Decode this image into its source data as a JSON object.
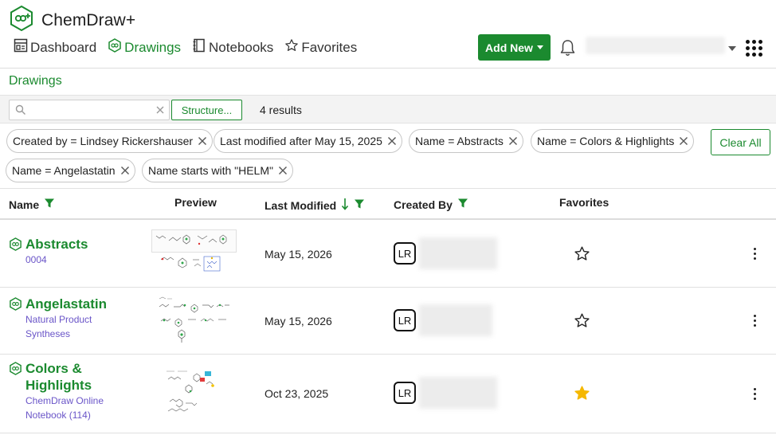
{
  "app": {
    "name": "ChemDraw+"
  },
  "nav": [
    {
      "label": "Dashboard",
      "icon": "dashboard-icon"
    },
    {
      "label": "Drawings",
      "icon": "drawing-icon",
      "active": true
    },
    {
      "label": "Notebooks",
      "icon": "notebook-icon"
    },
    {
      "label": "Favorites",
      "icon": "star-icon"
    }
  ],
  "header": {
    "add_new_label": "Add New"
  },
  "page": {
    "title": "Drawings"
  },
  "search": {
    "placeholder": "",
    "structure_label": "Structure...",
    "results_text": "4 results"
  },
  "filters": [
    {
      "label": "Created by = Lindsey Rickershauser"
    },
    {
      "label": "Last modified after May 15, 2025"
    },
    {
      "label": "Name = Abstracts"
    },
    {
      "label": "Name = Colors & Highlights"
    },
    {
      "label": "Name = Angelastatin"
    },
    {
      "label": "Name starts with \"HELM\""
    }
  ],
  "clear_all_label": "Clear All",
  "table": {
    "columns": {
      "name": "Name",
      "preview": "Preview",
      "last_modified": "Last Modified",
      "created_by": "Created By",
      "favorites": "Favorites"
    },
    "rows": [
      {
        "title": "Abstracts",
        "sub1": "0004",
        "sub2": "",
        "date": "May 15, 2026",
        "initials": "LR",
        "favorite": false
      },
      {
        "title": "Angelastatin",
        "sub1": "Natural Product",
        "sub2": "Syntheses",
        "date": "May 15, 2026",
        "initials": "LR",
        "favorite": false
      },
      {
        "title_line1": "Colors &",
        "title_line2": "Highlights",
        "sub1": "ChemDraw Online",
        "sub2": "Notebook (114)",
        "date": "Oct 23, 2025",
        "initials": "LR",
        "favorite": true
      }
    ]
  },
  "colors": {
    "brand_green": "#1b8a2f",
    "link_purple": "#6a55c8",
    "favorite_gold": "#f5b800"
  }
}
